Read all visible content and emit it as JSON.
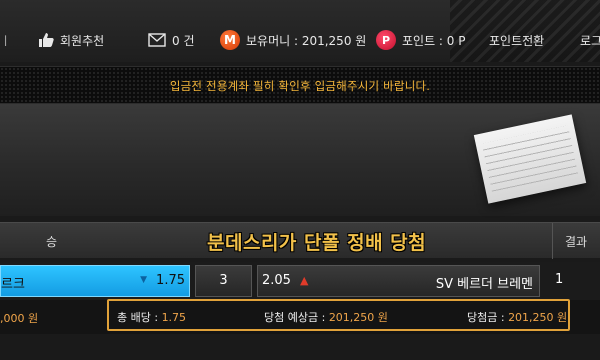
{
  "nav": {
    "left_fragment": "ㅣ",
    "recommend": "회원추천",
    "messages_count": "0 건",
    "money_label": "보유머니 : 201,250 원",
    "coin_letter": "M",
    "point_letter": "P",
    "points_label": "포인트 : 0 P",
    "point_convert": "포인트전환",
    "logout_fragment": "로그"
  },
  "notice": "입금전 전용계좌 필히 확인후 입금해주시기 바랍니다.",
  "overlay_title": "분데스리가 단폴 정배 당첨",
  "table": {
    "header_win": "승",
    "header_result": "결과"
  },
  "row": {
    "home_team": "르크",
    "home_odds": "1.75",
    "home_marker": "▼",
    "draw": "3",
    "away_odds": "2.05",
    "away_arrow": "▲",
    "away_team": "SV 베르더 브레멘",
    "result": "1"
  },
  "bet": {
    "left_amount": ",000 원",
    "total_odds_label": "총 배당 :",
    "total_odds": "1.75",
    "expected_label": "당첨 예상금 :",
    "expected": "201,250 원",
    "payout_label": "당첨금 :",
    "payout": "201,250 원"
  },
  "colors": {
    "accent": "#f0a54a",
    "home_cell": "#2ec4ff",
    "box_border": "#e1a23a"
  }
}
